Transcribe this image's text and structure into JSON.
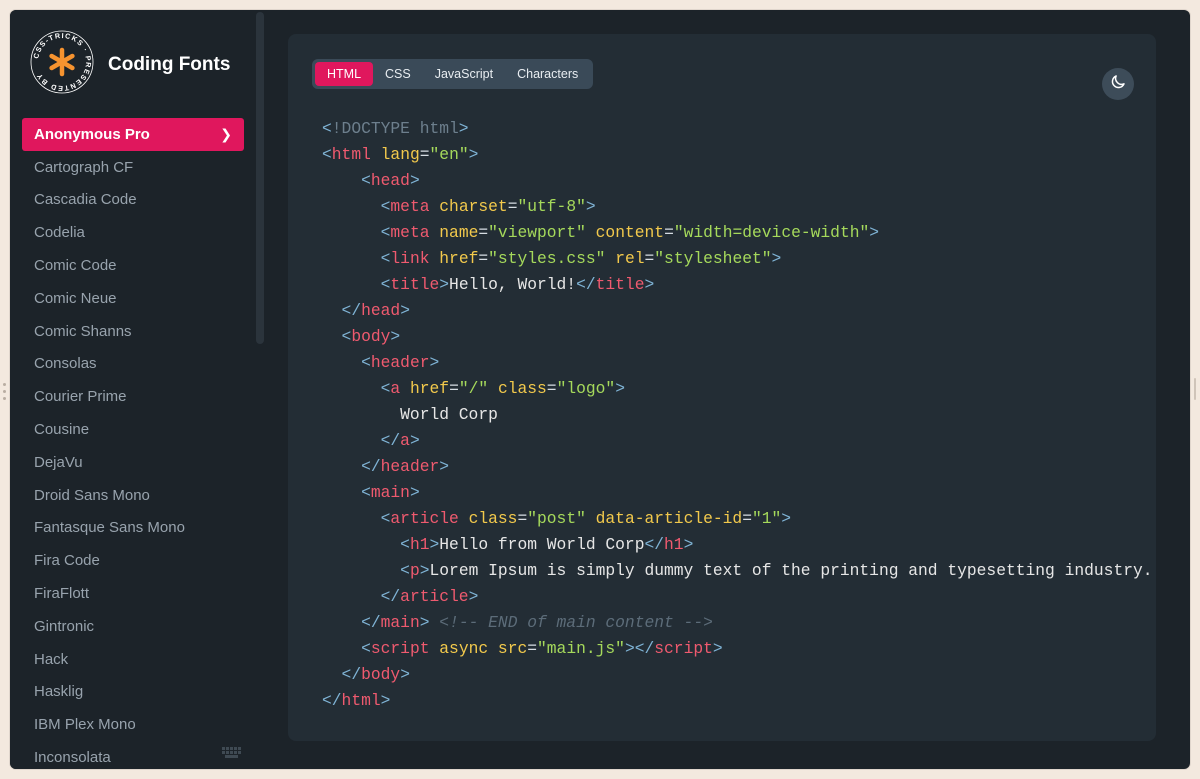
{
  "app": {
    "title": "Coding Fonts",
    "badge_text": "CSS-TRICKS · PRESENTED BY"
  },
  "colors": {
    "accent": "#e0175d",
    "sidebar_bg": "#1c2329",
    "panel_bg": "#232d35",
    "badge_asterisk": "#f6932f"
  },
  "sidebar": {
    "fonts": [
      "Anonymous Pro",
      "Cartograph CF",
      "Cascadia Code",
      "Codelia",
      "Comic Code",
      "Comic Neue",
      "Comic Shanns",
      "Consolas",
      "Courier Prime",
      "Cousine",
      "DejaVu",
      "Droid Sans Mono",
      "Fantasque Sans Mono",
      "Fira Code",
      "FiraFlott",
      "Gintronic",
      "Hack",
      "Hasklig",
      "IBM Plex Mono",
      "Inconsolata"
    ],
    "selected": "Anonymous Pro",
    "selected_chevron": "❯"
  },
  "tabs": [
    {
      "label": "HTML",
      "active": true
    },
    {
      "label": "CSS",
      "active": false
    },
    {
      "label": "JavaScript",
      "active": false
    },
    {
      "label": "Characters",
      "active": false
    }
  ],
  "theme_toggle": {
    "icon": "moon-icon"
  },
  "code_lines": [
    [
      {
        "k": "p",
        "v": "<"
      },
      {
        "k": "dt",
        "v": "!DOCTYPE html"
      },
      {
        "k": "p",
        "v": ">"
      }
    ],
    [
      {
        "k": "p",
        "v": "<"
      },
      {
        "k": "t",
        "v": "html"
      },
      {
        "k": "x",
        "v": " "
      },
      {
        "k": "a",
        "v": "lang"
      },
      {
        "k": "eq",
        "v": "="
      },
      {
        "k": "s",
        "v": "\"en\""
      },
      {
        "k": "p",
        "v": ">"
      }
    ],
    [
      {
        "k": "x",
        "v": "    "
      },
      {
        "k": "p",
        "v": "<"
      },
      {
        "k": "t",
        "v": "head"
      },
      {
        "k": "p",
        "v": ">"
      }
    ],
    [
      {
        "k": "x",
        "v": "      "
      },
      {
        "k": "p",
        "v": "<"
      },
      {
        "k": "t",
        "v": "meta"
      },
      {
        "k": "x",
        "v": " "
      },
      {
        "k": "a",
        "v": "charset"
      },
      {
        "k": "eq",
        "v": "="
      },
      {
        "k": "s",
        "v": "\"utf-8\""
      },
      {
        "k": "p",
        "v": ">"
      }
    ],
    [
      {
        "k": "x",
        "v": "      "
      },
      {
        "k": "p",
        "v": "<"
      },
      {
        "k": "t",
        "v": "meta"
      },
      {
        "k": "x",
        "v": " "
      },
      {
        "k": "a",
        "v": "name"
      },
      {
        "k": "eq",
        "v": "="
      },
      {
        "k": "s",
        "v": "\"viewport\""
      },
      {
        "k": "x",
        "v": " "
      },
      {
        "k": "a",
        "v": "content"
      },
      {
        "k": "eq",
        "v": "="
      },
      {
        "k": "s",
        "v": "\"width=device-width\""
      },
      {
        "k": "p",
        "v": ">"
      }
    ],
    [
      {
        "k": "x",
        "v": "      "
      },
      {
        "k": "p",
        "v": "<"
      },
      {
        "k": "t",
        "v": "link"
      },
      {
        "k": "x",
        "v": " "
      },
      {
        "k": "a",
        "v": "href"
      },
      {
        "k": "eq",
        "v": "="
      },
      {
        "k": "s",
        "v": "\"styles.css\""
      },
      {
        "k": "x",
        "v": " "
      },
      {
        "k": "a",
        "v": "rel"
      },
      {
        "k": "eq",
        "v": "="
      },
      {
        "k": "s",
        "v": "\"stylesheet\""
      },
      {
        "k": "p",
        "v": ">"
      }
    ],
    [
      {
        "k": "x",
        "v": "      "
      },
      {
        "k": "p",
        "v": "<"
      },
      {
        "k": "t",
        "v": "title"
      },
      {
        "k": "p",
        "v": ">"
      },
      {
        "k": "x",
        "v": "Hello, World!"
      },
      {
        "k": "p",
        "v": "</"
      },
      {
        "k": "t",
        "v": "title"
      },
      {
        "k": "p",
        "v": ">"
      }
    ],
    [
      {
        "k": "x",
        "v": "  "
      },
      {
        "k": "p",
        "v": "</"
      },
      {
        "k": "t",
        "v": "head"
      },
      {
        "k": "p",
        "v": ">"
      }
    ],
    [
      {
        "k": "x",
        "v": "  "
      },
      {
        "k": "p",
        "v": "<"
      },
      {
        "k": "t",
        "v": "body"
      },
      {
        "k": "p",
        "v": ">"
      }
    ],
    [
      {
        "k": "x",
        "v": "    "
      },
      {
        "k": "p",
        "v": "<"
      },
      {
        "k": "t",
        "v": "header"
      },
      {
        "k": "p",
        "v": ">"
      }
    ],
    [
      {
        "k": "x",
        "v": "      "
      },
      {
        "k": "p",
        "v": "<"
      },
      {
        "k": "t",
        "v": "a"
      },
      {
        "k": "x",
        "v": " "
      },
      {
        "k": "a",
        "v": "href"
      },
      {
        "k": "eq",
        "v": "="
      },
      {
        "k": "s",
        "v": "\"/\""
      },
      {
        "k": "x",
        "v": " "
      },
      {
        "k": "a",
        "v": "class"
      },
      {
        "k": "eq",
        "v": "="
      },
      {
        "k": "s",
        "v": "\"logo\""
      },
      {
        "k": "p",
        "v": ">"
      }
    ],
    [
      {
        "k": "x",
        "v": "        World Corp"
      }
    ],
    [
      {
        "k": "x",
        "v": "      "
      },
      {
        "k": "p",
        "v": "</"
      },
      {
        "k": "t",
        "v": "a"
      },
      {
        "k": "p",
        "v": ">"
      }
    ],
    [
      {
        "k": "x",
        "v": "    "
      },
      {
        "k": "p",
        "v": "</"
      },
      {
        "k": "t",
        "v": "header"
      },
      {
        "k": "p",
        "v": ">"
      }
    ],
    [
      {
        "k": "x",
        "v": "    "
      },
      {
        "k": "p",
        "v": "<"
      },
      {
        "k": "t",
        "v": "main"
      },
      {
        "k": "p",
        "v": ">"
      }
    ],
    [
      {
        "k": "x",
        "v": "      "
      },
      {
        "k": "p",
        "v": "<"
      },
      {
        "k": "t",
        "v": "article"
      },
      {
        "k": "x",
        "v": " "
      },
      {
        "k": "a",
        "v": "class"
      },
      {
        "k": "eq",
        "v": "="
      },
      {
        "k": "s",
        "v": "\"post\""
      },
      {
        "k": "x",
        "v": " "
      },
      {
        "k": "a",
        "v": "data-article-id"
      },
      {
        "k": "eq",
        "v": "="
      },
      {
        "k": "s",
        "v": "\"1\""
      },
      {
        "k": "p",
        "v": ">"
      }
    ],
    [
      {
        "k": "x",
        "v": "        "
      },
      {
        "k": "p",
        "v": "<"
      },
      {
        "k": "t",
        "v": "h1"
      },
      {
        "k": "p",
        "v": ">"
      },
      {
        "k": "x",
        "v": "Hello from World Corp"
      },
      {
        "k": "p",
        "v": "</"
      },
      {
        "k": "t",
        "v": "h1"
      },
      {
        "k": "p",
        "v": ">"
      }
    ],
    [
      {
        "k": "x",
        "v": "        "
      },
      {
        "k": "p",
        "v": "<"
      },
      {
        "k": "t",
        "v": "p"
      },
      {
        "k": "p",
        "v": ">"
      },
      {
        "k": "x",
        "v": "Lorem Ipsum is simply dummy text of the printing and typesetting industry..."
      },
      {
        "k": "p",
        "v": "<"
      }
    ],
    [
      {
        "k": "x",
        "v": "      "
      },
      {
        "k": "p",
        "v": "</"
      },
      {
        "k": "t",
        "v": "article"
      },
      {
        "k": "p",
        "v": ">"
      }
    ],
    [
      {
        "k": "x",
        "v": "    "
      },
      {
        "k": "p",
        "v": "</"
      },
      {
        "k": "t",
        "v": "main"
      },
      {
        "k": "p",
        "v": ">"
      },
      {
        "k": "x",
        "v": " "
      },
      {
        "k": "c",
        "v": "<!-- END of main content -->"
      }
    ],
    [
      {
        "k": "x",
        "v": "    "
      },
      {
        "k": "p",
        "v": "<"
      },
      {
        "k": "t",
        "v": "script"
      },
      {
        "k": "x",
        "v": " "
      },
      {
        "k": "a",
        "v": "async"
      },
      {
        "k": "x",
        "v": " "
      },
      {
        "k": "a",
        "v": "src"
      },
      {
        "k": "eq",
        "v": "="
      },
      {
        "k": "s",
        "v": "\"main.js\""
      },
      {
        "k": "p",
        "v": "></"
      },
      {
        "k": "t",
        "v": "script"
      },
      {
        "k": "p",
        "v": ">"
      }
    ],
    [
      {
        "k": "x",
        "v": "  "
      },
      {
        "k": "p",
        "v": "</"
      },
      {
        "k": "t",
        "v": "body"
      },
      {
        "k": "p",
        "v": ">"
      }
    ],
    [
      {
        "k": "p",
        "v": "</"
      },
      {
        "k": "t",
        "v": "html"
      },
      {
        "k": "p",
        "v": ">"
      }
    ]
  ]
}
